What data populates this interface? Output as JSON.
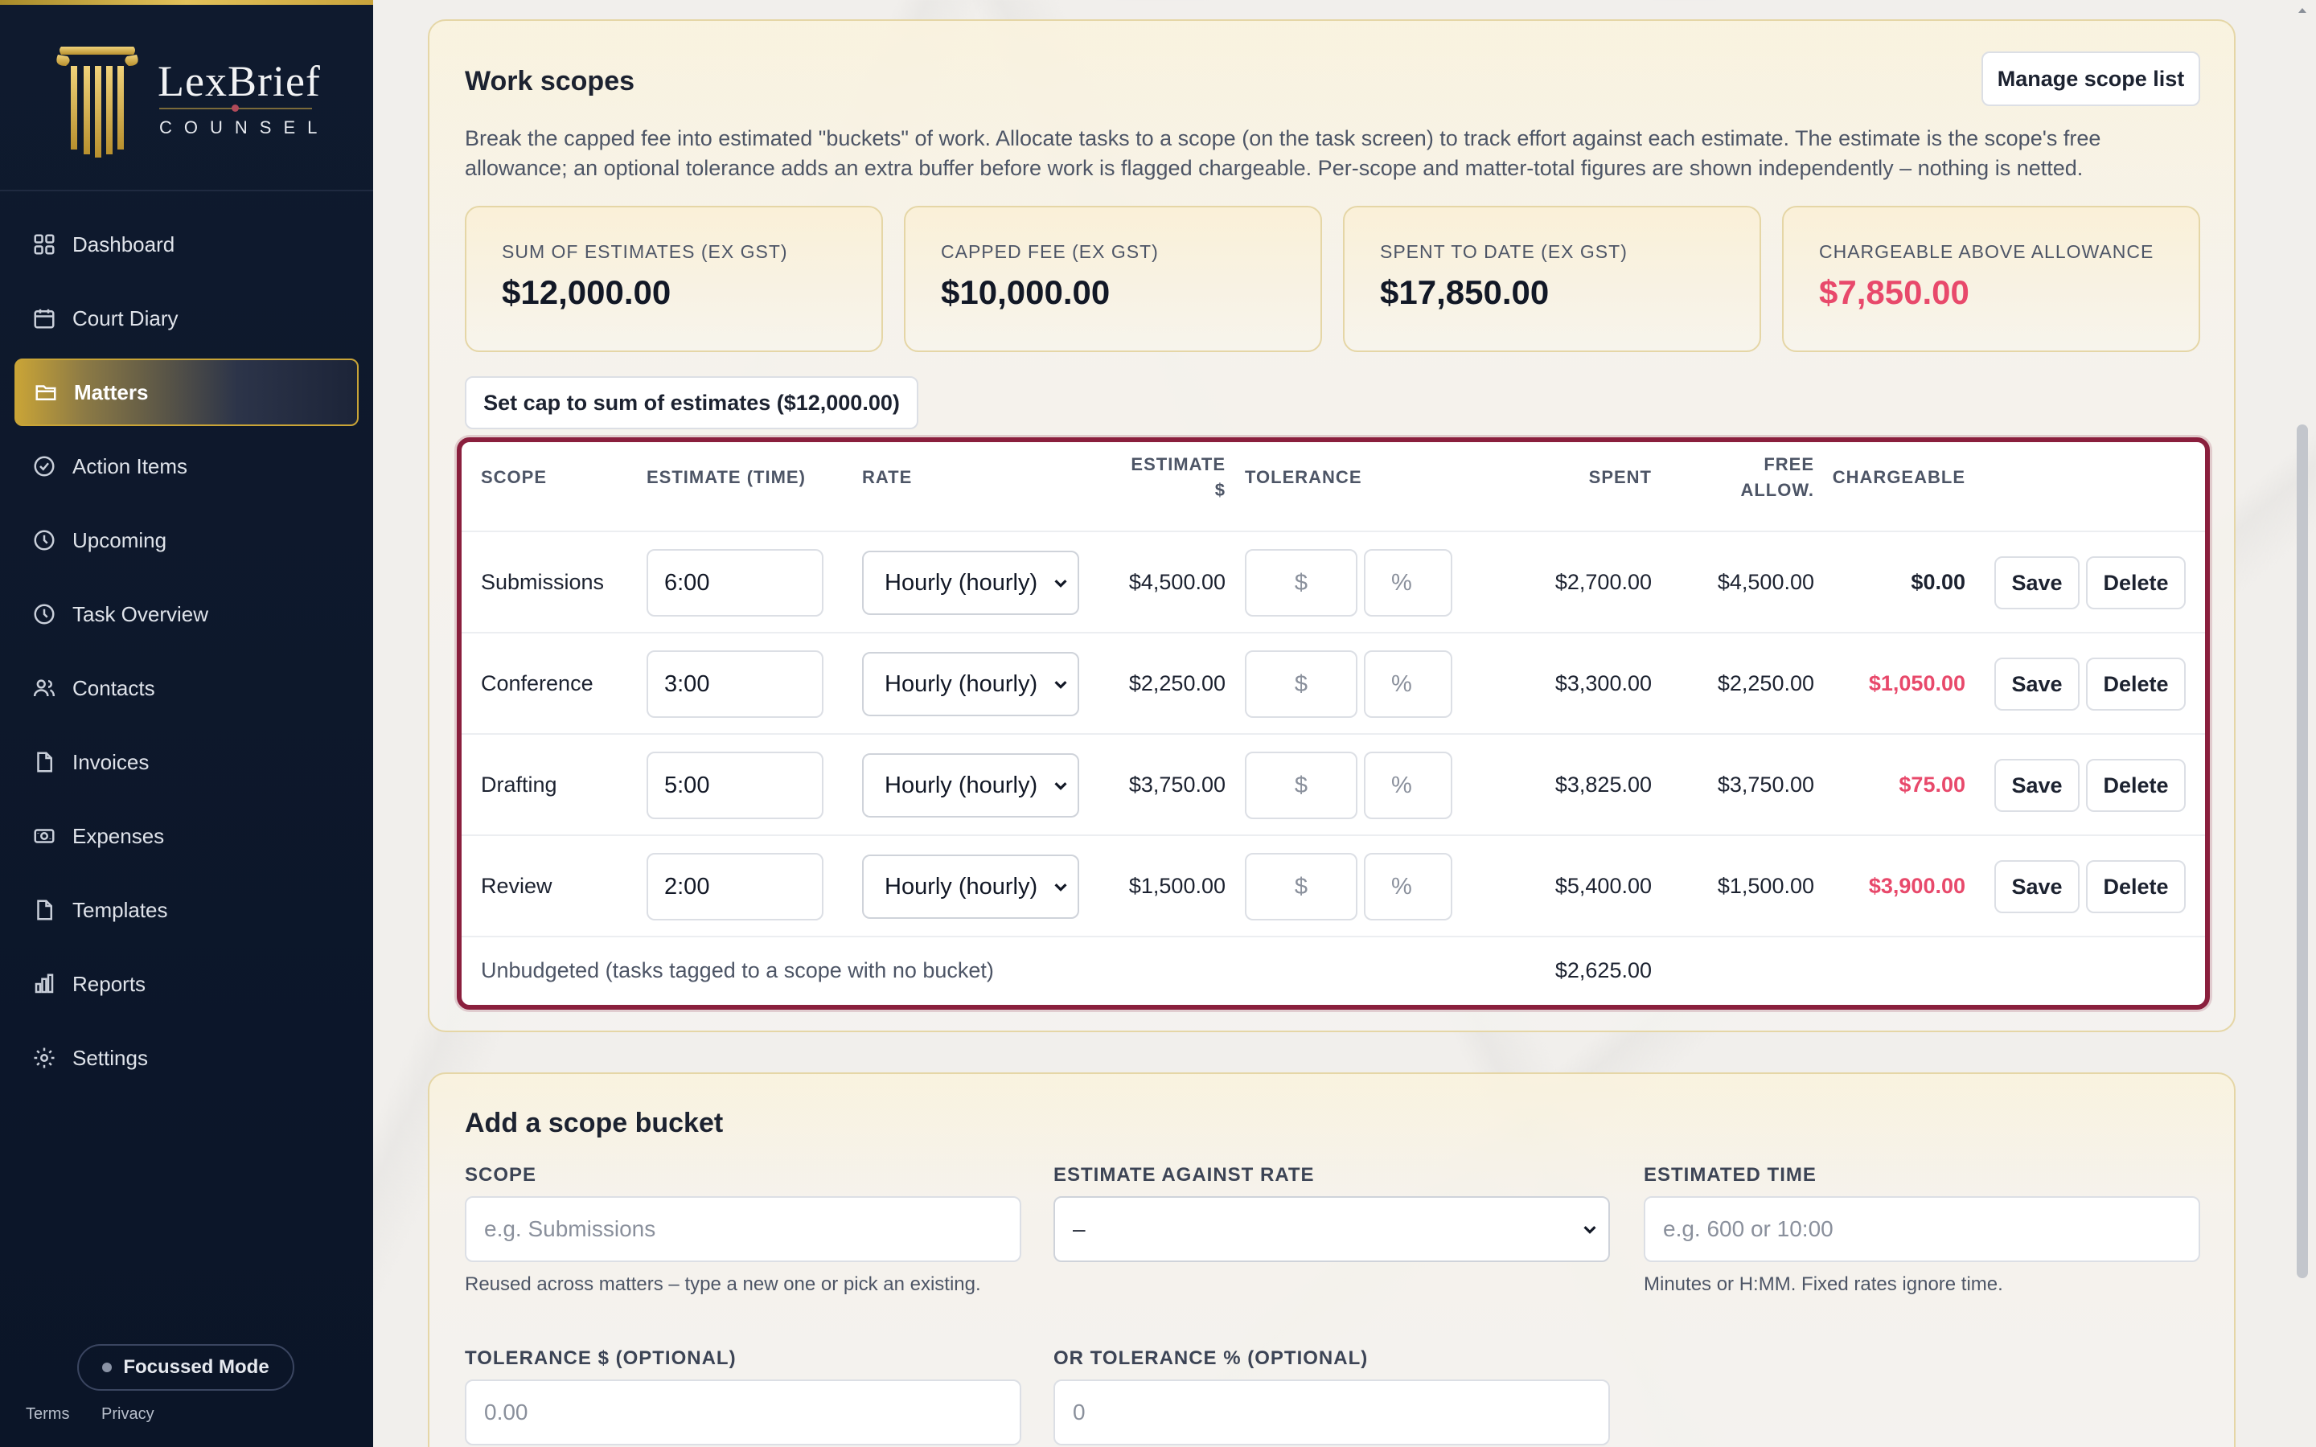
{
  "brand": {
    "name": "LexBrief",
    "sub": "COUNSEL"
  },
  "nav": [
    {
      "label": "Dashboard",
      "icon": "grid-icon",
      "active": false
    },
    {
      "label": "Court Diary",
      "icon": "calendar-icon",
      "active": false
    },
    {
      "label": "Matters",
      "icon": "folder-icon",
      "active": true
    },
    {
      "label": "Action Items",
      "icon": "check-circle-icon",
      "active": false
    },
    {
      "label": "Upcoming",
      "icon": "clock-icon",
      "active": false
    },
    {
      "label": "Task Overview",
      "icon": "clock-icon",
      "active": false
    },
    {
      "label": "Contacts",
      "icon": "users-icon",
      "active": false
    },
    {
      "label": "Invoices",
      "icon": "document-icon",
      "active": false
    },
    {
      "label": "Expenses",
      "icon": "money-icon",
      "active": false
    },
    {
      "label": "Templates",
      "icon": "document-icon",
      "active": false
    },
    {
      "label": "Reports",
      "icon": "bar-chart-icon",
      "active": false
    },
    {
      "label": "Settings",
      "icon": "gear-icon",
      "active": false
    }
  ],
  "focus_mode": "Focussed Mode",
  "footer": {
    "terms": "Terms",
    "privacy": "Privacy"
  },
  "work_scopes": {
    "title": "Work scopes",
    "manage_btn": "Manage scope list",
    "description": "Break the capped fee into estimated \"buckets\" of work. Allocate tasks to a scope (on the task screen) to track effort against each estimate. The estimate is the scope's free allowance; an optional tolerance adds an extra buffer before work is flagged chargeable. Per-scope and matter-total figures are shown independently – nothing is netted.",
    "stats": [
      {
        "label": "SUM OF ESTIMATES (EX GST)",
        "value": "$12,000.00"
      },
      {
        "label": "CAPPED FEE (EX GST)",
        "value": "$10,000.00"
      },
      {
        "label": "SPENT TO DATE (EX GST)",
        "value": "$17,850.00"
      },
      {
        "label": "CHARGEABLE ABOVE ALLOWANCE",
        "value": "$7,850.00"
      }
    ],
    "set_cap_btn": "Set cap to sum of estimates ($12,000.00)",
    "headers": {
      "scope": "SCOPE",
      "estimate_time": "ESTIMATE (TIME)",
      "rate": "RATE",
      "estimate_d1": "ESTIMATE",
      "estimate_d2": "$",
      "tolerance": "TOLERANCE",
      "spent": "SPENT",
      "free1": "FREE",
      "free2": "ALLOW.",
      "chargeable": "CHARGEABLE"
    },
    "rows": [
      {
        "scope": "Submissions",
        "time": "6:00",
        "rate": "Hourly (hourly)",
        "estimate": "$4,500.00",
        "tol_d": "$",
        "tol_p": "%",
        "spent": "$2,700.00",
        "free": "$4,500.00",
        "chargeable": "$0.00",
        "save": "Save",
        "delete": "Delete"
      },
      {
        "scope": "Conference",
        "time": "3:00",
        "rate": "Hourly (hourly)",
        "estimate": "$2,250.00",
        "tol_d": "$",
        "tol_p": "%",
        "spent": "$3,300.00",
        "free": "$2,250.00",
        "chargeable": "$1,050.00",
        "save": "Save",
        "delete": "Delete"
      },
      {
        "scope": "Drafting",
        "time": "5:00",
        "rate": "Hourly (hourly)",
        "estimate": "$3,750.00",
        "tol_d": "$",
        "tol_p": "%",
        "spent": "$3,825.00",
        "free": "$3,750.00",
        "chargeable": "$75.00",
        "save": "Save",
        "delete": "Delete"
      },
      {
        "scope": "Review",
        "time": "2:00",
        "rate": "Hourly (hourly)",
        "estimate": "$1,500.00",
        "tol_d": "$",
        "tol_p": "%",
        "spent": "$5,400.00",
        "free": "$1,500.00",
        "chargeable": "$3,900.00",
        "save": "Save",
        "delete": "Delete"
      }
    ],
    "unbudgeted": {
      "label": "Unbudgeted (tasks tagged to a scope with no bucket)",
      "spent": "$2,625.00"
    },
    "colors": {
      "accent_red": "#e8496b",
      "highlight_border": "#8a1f3d",
      "gold": "#c9a437"
    }
  },
  "add_scope": {
    "title": "Add a scope bucket",
    "scope_label": "SCOPE",
    "scope_placeholder": "e.g. Submissions",
    "scope_help": "Reused across matters – type a new one or pick an existing.",
    "rate_label": "ESTIMATE AGAINST RATE",
    "rate_value": "–",
    "time_label": "ESTIMATED TIME",
    "time_placeholder": "e.g. 600 or 10:00",
    "time_help": "Minutes or H:MM. Fixed rates ignore time.",
    "tol_d_label": "TOLERANCE $ (OPTIONAL)",
    "tol_d_placeholder": "0.00",
    "tol_p_label": "OR TOLERANCE % (OPTIONAL)",
    "tol_p_placeholder": "0"
  }
}
